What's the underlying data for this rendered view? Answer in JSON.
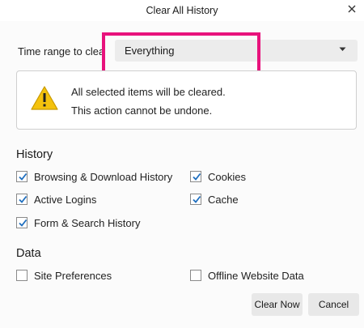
{
  "window": {
    "title": "Clear All History"
  },
  "time_range": {
    "label": "Time range to clea",
    "selected": "Everything"
  },
  "warning": {
    "line1": "All selected items will be cleared.",
    "line2": "This action cannot be undone."
  },
  "history": {
    "heading": "History",
    "items": [
      {
        "label": "Browsing & Download History",
        "checked": true
      },
      {
        "label": "Cookies",
        "checked": true
      },
      {
        "label": "Active Logins",
        "checked": true
      },
      {
        "label": "Cache",
        "checked": true
      },
      {
        "label": "Form & Search History",
        "checked": true
      }
    ]
  },
  "data": {
    "heading": "Data",
    "items": [
      {
        "label": "Site Preferences",
        "checked": false
      },
      {
        "label": "Offline Website Data",
        "checked": false
      }
    ]
  },
  "buttons": {
    "clear_now": "Clear Now",
    "cancel": "Cancel"
  },
  "colors": {
    "highlight": "#e8127c",
    "check": "#1f6fbf",
    "warning_yellow": "#f4c20d"
  }
}
